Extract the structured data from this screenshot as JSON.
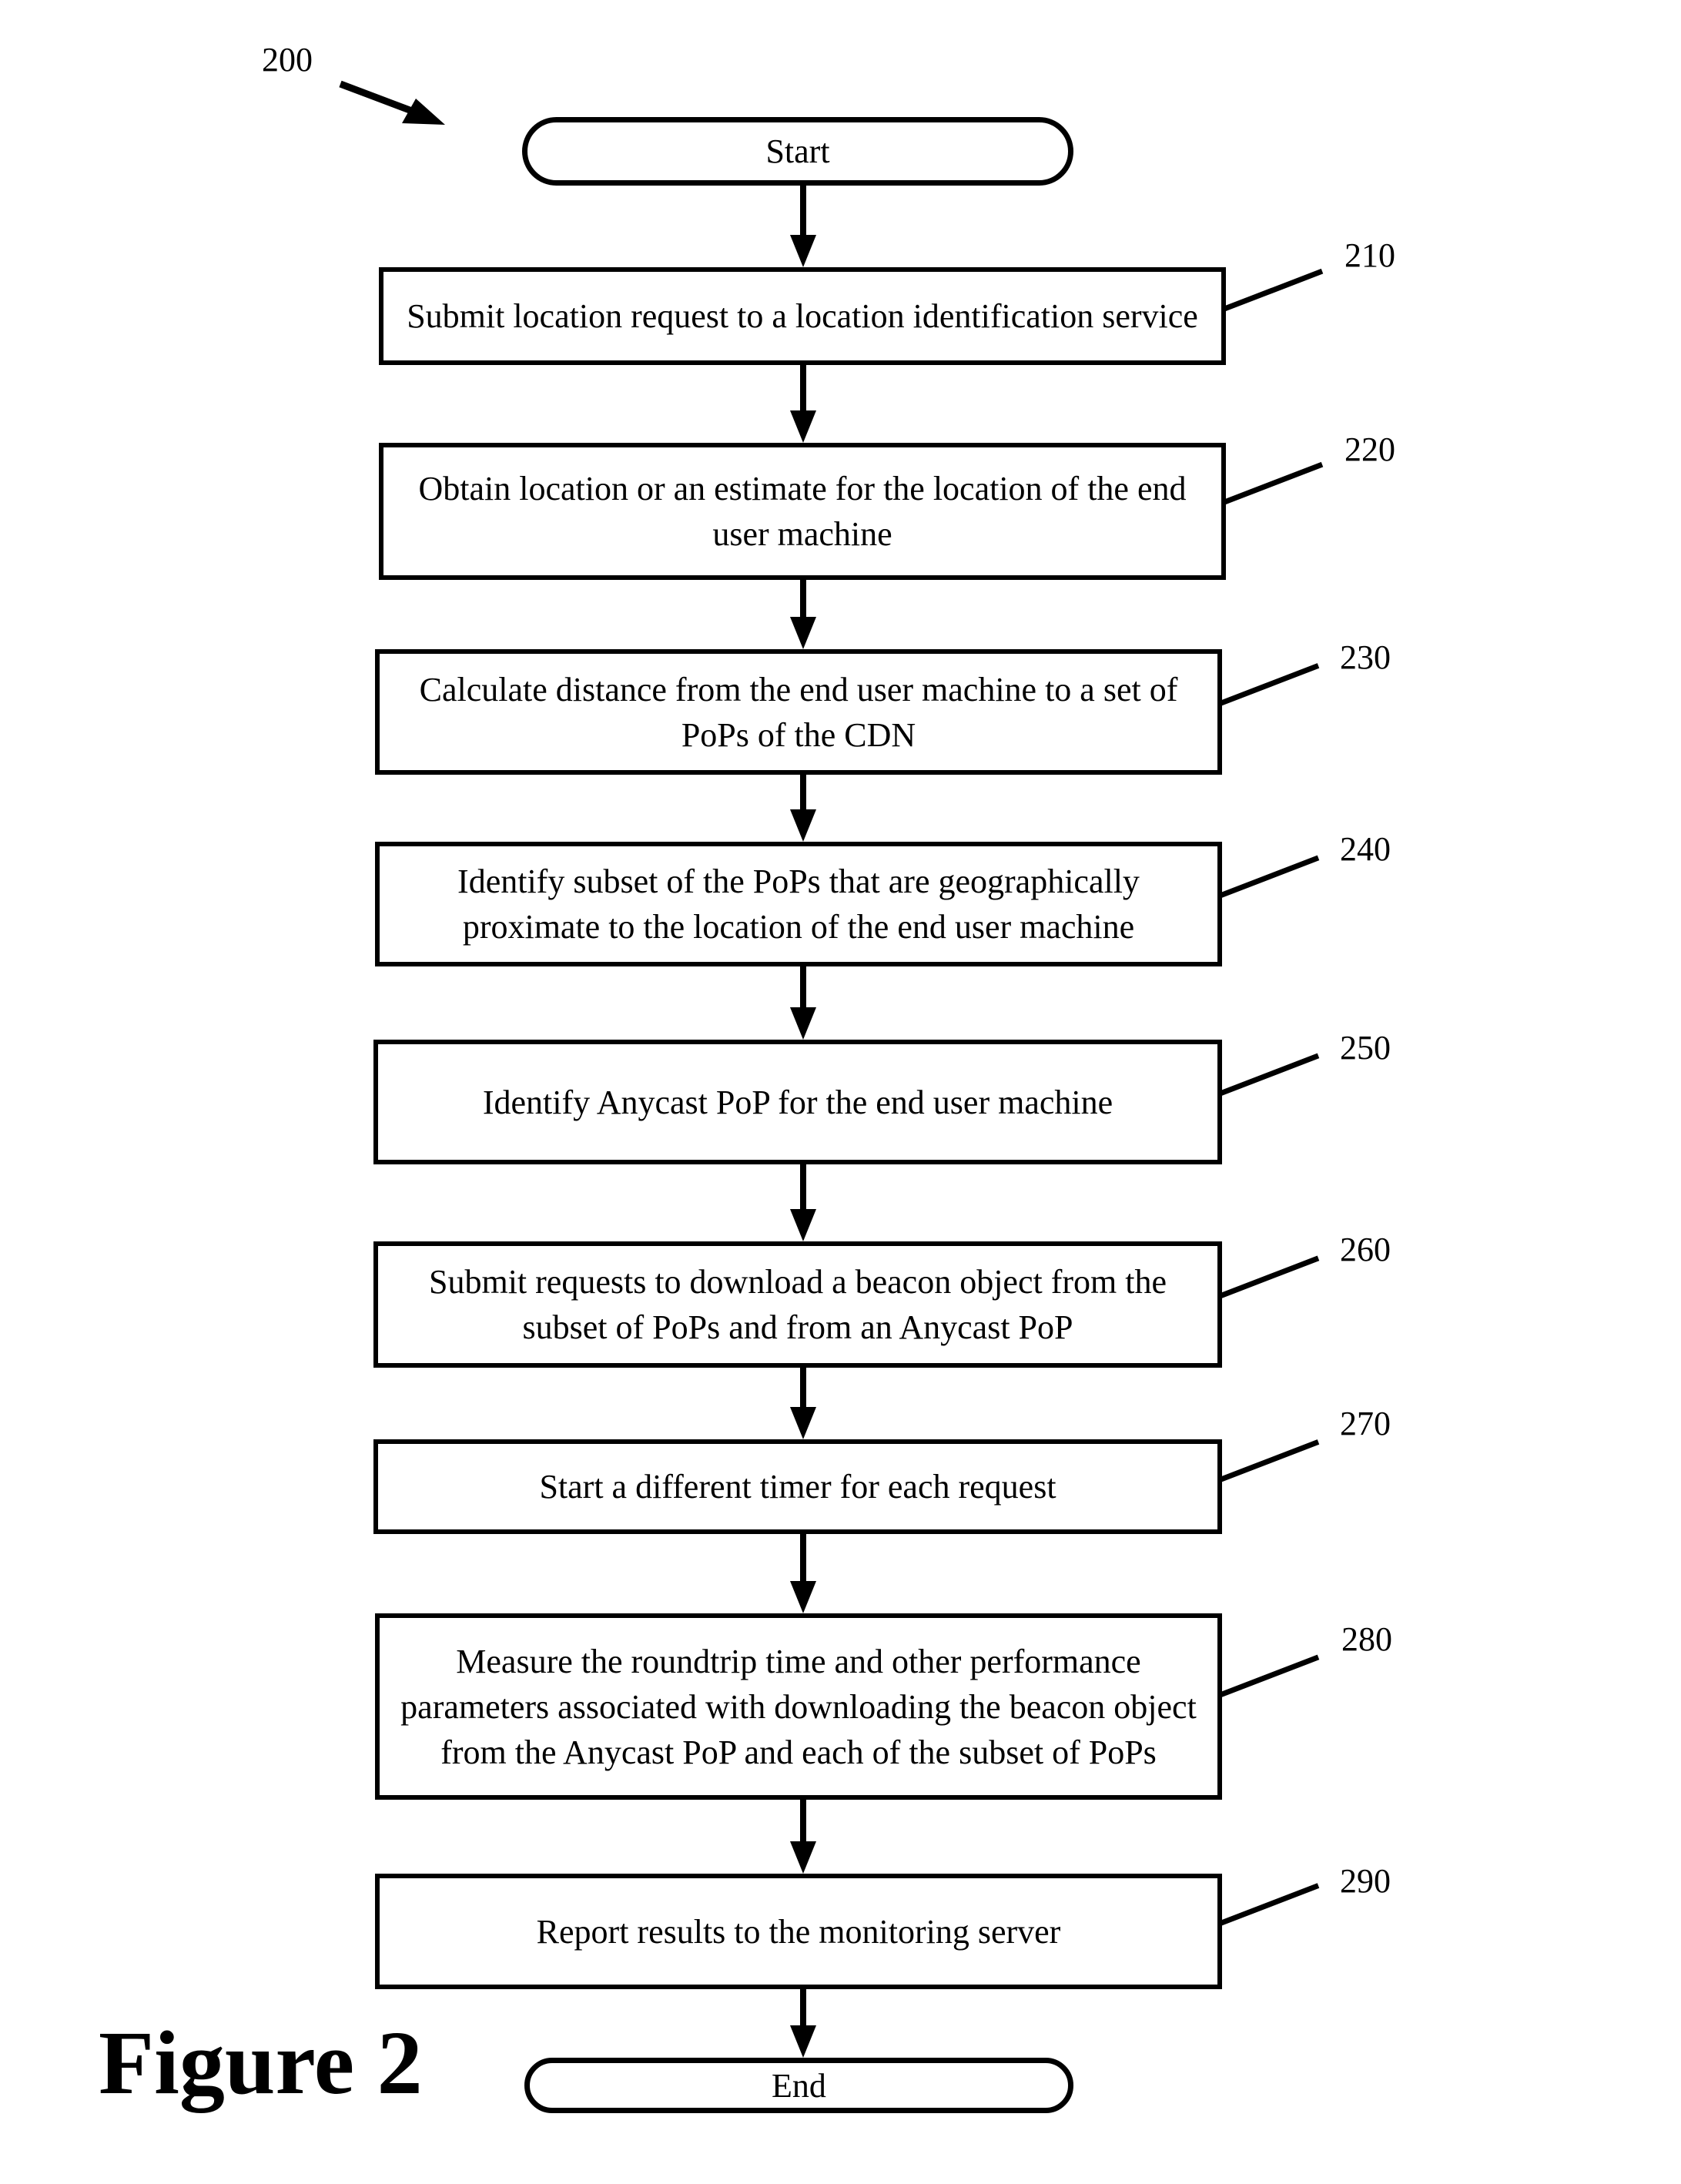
{
  "figure": {
    "title": "Figure 2",
    "reference": "200"
  },
  "flowchart": {
    "start": {
      "label": "Start"
    },
    "end": {
      "label": "End"
    },
    "steps": [
      {
        "ref": "210",
        "text": "Submit location request to a location identification service"
      },
      {
        "ref": "220",
        "text": "Obtain location or an estimate for the location of the end user machine"
      },
      {
        "ref": "230",
        "text": "Calculate distance from the end user machine to a set of PoPs of the CDN"
      },
      {
        "ref": "240",
        "text": "Identify subset of the PoPs that are geographically proximate to the location of the end user machine"
      },
      {
        "ref": "250",
        "text": "Identify Anycast PoP for the end user machine"
      },
      {
        "ref": "260",
        "text": "Submit requests to download a beacon object from the subset of PoPs and from an Anycast PoP"
      },
      {
        "ref": "270",
        "text": "Start a different timer for each request"
      },
      {
        "ref": "280",
        "text": "Measure the roundtrip time and other performance parameters associated with downloading the beacon object from the Anycast PoP and each of the subset of PoPs"
      },
      {
        "ref": "290",
        "text": "Report results to the monitoring server"
      }
    ]
  }
}
